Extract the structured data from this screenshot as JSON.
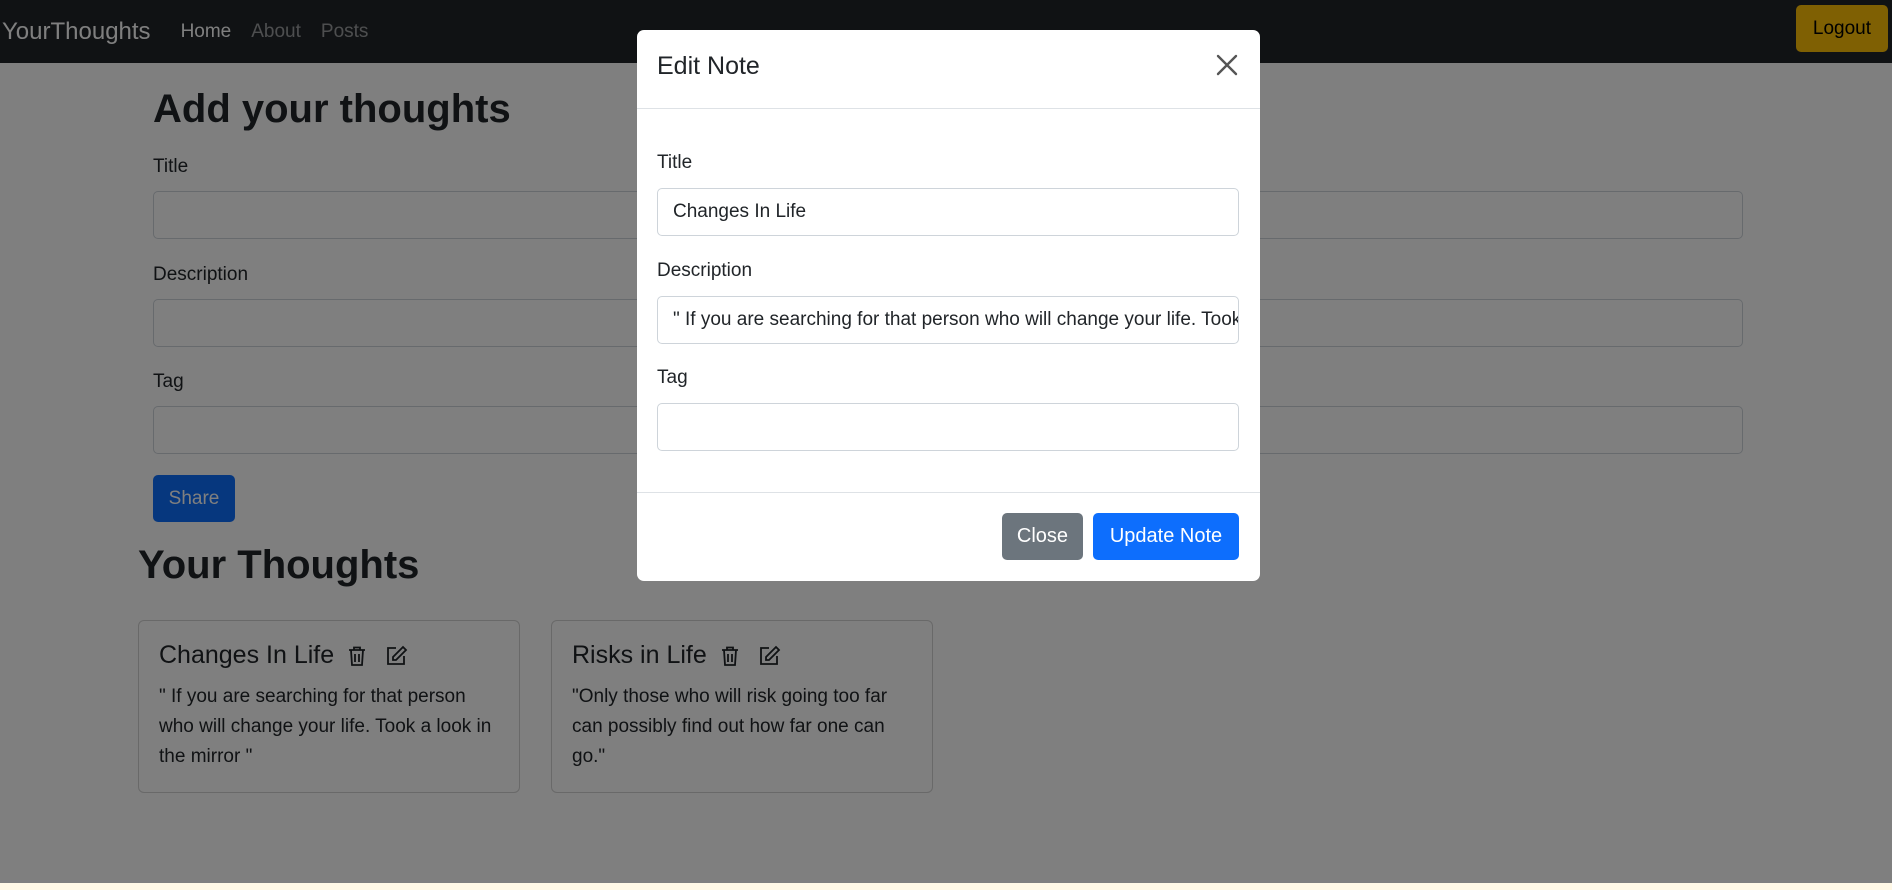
{
  "navbar": {
    "brand": "YourThoughts",
    "links": [
      {
        "label": "Home",
        "active": true
      },
      {
        "label": "About",
        "active": false
      },
      {
        "label": "Posts",
        "active": false
      }
    ],
    "logout_label": "Logout"
  },
  "add_form": {
    "heading": "Add your thoughts",
    "title_label": "Title",
    "description_label": "Description",
    "tag_label": "Tag",
    "share_label": "Share"
  },
  "notes_section": {
    "heading": "Your Thoughts",
    "notes": [
      {
        "title": "Changes In Life",
        "description": "\" If you are searching for that person who will change your life. Took a look in the mirror \""
      },
      {
        "title": "Risks in Life",
        "description": "\"Only those who will risk going too far can possibly find out how far one can go.\""
      }
    ]
  },
  "modal": {
    "title": "Edit Note",
    "title_label": "Title",
    "title_value": "Changes In Life",
    "description_label": "Description",
    "description_value": "\" If you are searching for that person who will change your life. Took a look in the mirror \"",
    "tag_label": "Tag",
    "tag_value": "",
    "close_label": "Close",
    "update_label": "Update Note"
  },
  "colors": {
    "navbar_bg": "#212529",
    "primary": "#0d6efd",
    "secondary": "#6c757d",
    "warning": "#ffc107"
  },
  "icons": {
    "delete": "trash-icon",
    "edit": "pencil-square-icon",
    "close": "close-x-icon"
  }
}
